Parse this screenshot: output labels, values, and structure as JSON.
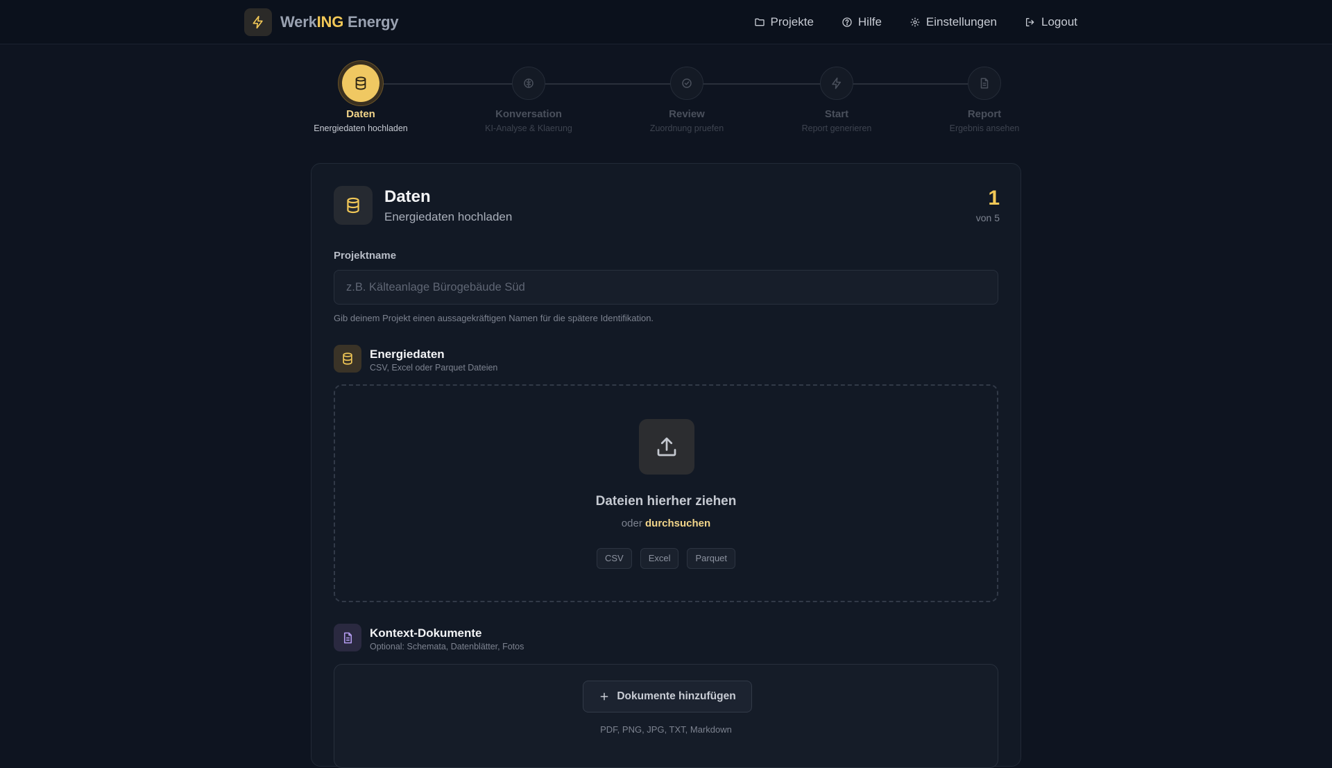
{
  "brand": {
    "part1": "Werk",
    "part2": "ING",
    "part3": " Energy",
    "logo_icon": "bolt-icon"
  },
  "nav": [
    {
      "label": "Projekte",
      "icon": "folder-icon"
    },
    {
      "label": "Hilfe",
      "icon": "help-circle-icon"
    },
    {
      "label": "Einstellungen",
      "icon": "gear-icon"
    },
    {
      "label": "Logout",
      "icon": "logout-icon"
    }
  ],
  "steps": [
    {
      "label": "Daten",
      "sub": "Energiedaten hochladen",
      "icon": "database-icon",
      "active": true
    },
    {
      "label": "Konversation",
      "sub": "KI-Analyse & Klaerung",
      "icon": "brain-icon",
      "active": false
    },
    {
      "label": "Review",
      "sub": "Zuordnung pruefen",
      "icon": "check-circle-icon",
      "active": false
    },
    {
      "label": "Start",
      "sub": "Report generieren",
      "icon": "bolt-icon",
      "active": false
    },
    {
      "label": "Report",
      "sub": "Ergebnis ansehen",
      "icon": "document-icon",
      "active": false
    }
  ],
  "card": {
    "title": "Daten",
    "subtitle": "Energiedaten hochladen",
    "step_number": "1",
    "step_of": "von 5",
    "project_name_label": "Projektname",
    "project_name_placeholder": "z.B. Kälteanlage Bürogebäude Süd",
    "project_name_value": "",
    "project_name_hint": "Gib deinem Projekt einen aussagekräftigen Namen für die spätere Identifikation.",
    "energy": {
      "title": "Energiedaten",
      "subtitle": "CSV, Excel oder Parquet Dateien",
      "drop_title": "Dateien hierher ziehen",
      "drop_or": "oder ",
      "browse": "durchsuchen",
      "formats": [
        "CSV",
        "Excel",
        "Parquet"
      ]
    },
    "context": {
      "title": "Kontext-Dokumente",
      "subtitle": "Optional: Schemata, Datenblätter, Fotos",
      "add_button": "Dokumente hinzufügen",
      "formats": "PDF, PNG, JPG, TXT, Markdown"
    }
  },
  "colors": {
    "accent": "#f2c857",
    "background": "#0e1420",
    "card": "#121925"
  }
}
